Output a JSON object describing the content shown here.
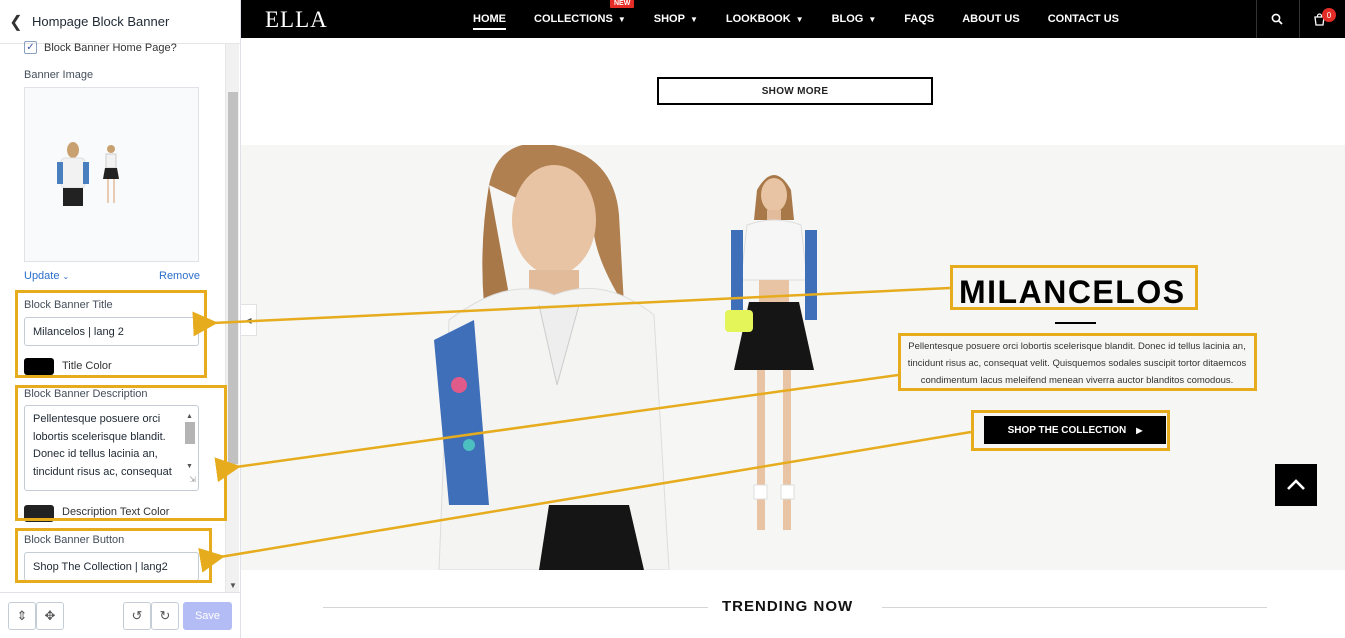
{
  "panel": {
    "title": "Hompage Block Banner",
    "checkbox_label": "Block Banner Home Page?",
    "image_label": "Banner Image",
    "update_label": "Update",
    "remove_label": "Remove",
    "title_field_label": "Block Banner Title",
    "title_value": "Milancelos | lang 2",
    "title_color_label": "Title Color",
    "title_color": "#000000",
    "desc_field_label": "Block Banner Description",
    "desc_value": "Pellentesque posuere orci lobortis scelerisque blandit. Donec id tellus lacinia an, tincidunt risus ac, consequat",
    "desc_color_label": "Description Text Color",
    "desc_color": "#222222",
    "button_field_label": "Block Banner Button",
    "button_value": "Shop The Collection | lang2",
    "save_label": "Save"
  },
  "site": {
    "logo": "ELLA",
    "nav": [
      {
        "label": "HOME",
        "caret": false,
        "active": true
      },
      {
        "label": "COLLECTIONS",
        "caret": true,
        "badge": "NEW"
      },
      {
        "label": "SHOP",
        "caret": true
      },
      {
        "label": "LOOKBOOK",
        "caret": true
      },
      {
        "label": "BLOG",
        "caret": true
      },
      {
        "label": "FAQS",
        "caret": false
      },
      {
        "label": "ABOUT US",
        "caret": false
      },
      {
        "label": "CONTACT US",
        "caret": false
      }
    ],
    "new_badge": "NEW",
    "cart_count": "0",
    "show_more": "SHOW MORE",
    "banner_title": "MILANCELOS",
    "banner_desc": "Pellentesque posuere orci lobortis scelerisque blandit. Donec id tellus lacinia an, tincidunt risus ac, consequat velit. Quisquemos sodales suscipit tortor ditaemcos condimentum lacus meleifend menean viverra auctor blanditos comodous.",
    "banner_button": "SHOP THE COLLECTION",
    "trending": "TRENDING NOW"
  },
  "colors": {
    "highlight": "#e6ac1e",
    "accent_red": "#e52d27",
    "link_blue": "#2c6ecb"
  },
  "icons": [
    "chevron-left-icon",
    "checkmark-icon",
    "search-icon",
    "cart-icon",
    "chevron-up-icon",
    "undo-icon",
    "redo-icon",
    "desktop-width-icon",
    "inspect-icon",
    "chevron-right-icon"
  ]
}
